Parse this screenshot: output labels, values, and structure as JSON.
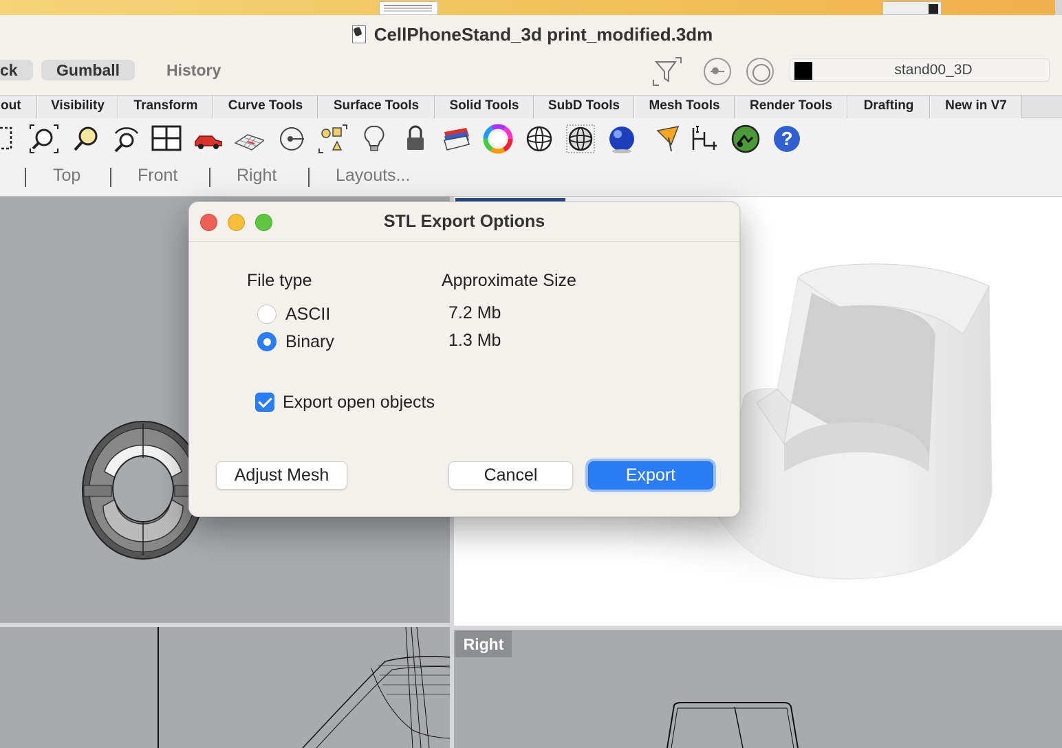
{
  "window": {
    "title": "CellPhoneStand_3d print_modified.3dm"
  },
  "toolbar": {
    "lock_label": "ck",
    "gumball_label": "Gumball",
    "history_label": "History",
    "layer_name": "stand00_3D",
    "layer_color": "#000000"
  },
  "tabs": [
    {
      "label": "out"
    },
    {
      "label": "Visibility"
    },
    {
      "label": "Transform"
    },
    {
      "label": "Curve Tools"
    },
    {
      "label": "Surface Tools"
    },
    {
      "label": "Solid Tools"
    },
    {
      "label": "SubD Tools"
    },
    {
      "label": "Mesh Tools"
    },
    {
      "label": "Render Tools"
    },
    {
      "label": "Drafting"
    },
    {
      "label": "New in V7"
    }
  ],
  "tool_icons": [
    "select-window-icon",
    "zoom-extents-icon",
    "zoom-selected-icon",
    "rotate-view-icon",
    "four-viewports-icon",
    "car-icon",
    "cplane-grid-icon",
    "point-on-object-icon",
    "shapes-icon",
    "light-bulb-icon",
    "lock-icon",
    "layers-stack-icon",
    "color-wheel-icon",
    "sphere-wireframe-icon",
    "sphere-mesh-icon",
    "render-sphere-icon",
    "shader-icon",
    "dimension-icon",
    "environment-icon",
    "help-icon"
  ],
  "view_tabs": [
    {
      "label": "Top"
    },
    {
      "label": "Front"
    },
    {
      "label": "Right"
    },
    {
      "label": "Layouts..."
    }
  ],
  "viewports": {
    "bottom_right_label": "Right"
  },
  "dialog": {
    "title": "STL Export Options",
    "file_type_label": "File type",
    "approx_size_label": "Approximate Size",
    "options": [
      {
        "label": "ASCII",
        "size": "7.2 Mb",
        "selected": false
      },
      {
        "label": "Binary",
        "size": "1.3 Mb",
        "selected": true
      }
    ],
    "export_open_objects_label": "Export open objects",
    "export_open_objects_checked": true,
    "adjust_mesh_label": "Adjust Mesh",
    "cancel_label": "Cancel",
    "export_label": "Export",
    "accent_color": "#2c7cf3"
  }
}
